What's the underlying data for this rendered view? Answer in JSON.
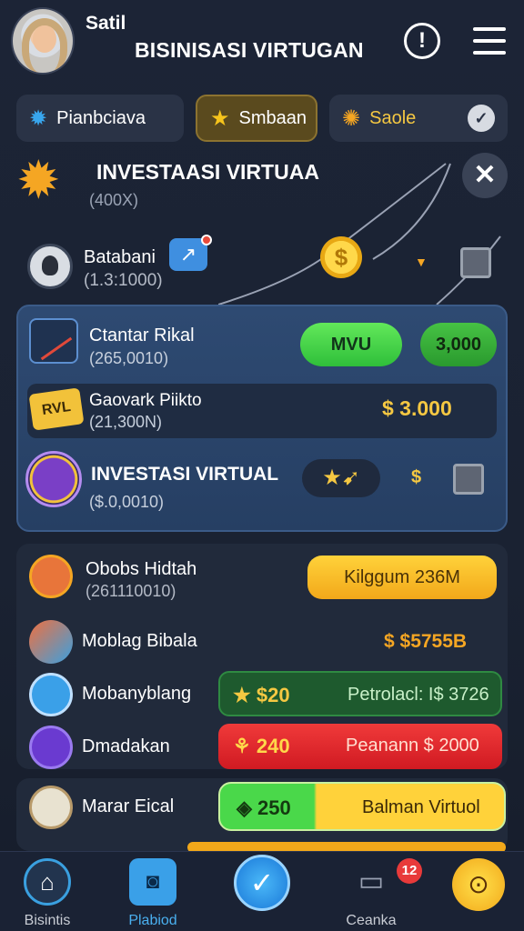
{
  "header": {
    "user_name": "Satil",
    "title": "BISINISASI VIRTUGAN"
  },
  "chips": [
    {
      "label": "Pianbciava",
      "icon": "gear-icon"
    },
    {
      "label": "Smbaan",
      "icon": "star-icon"
    },
    {
      "label": "Saole",
      "icon": "gear-icon"
    }
  ],
  "investasi": {
    "title": "INVESTAASI VIRTUAA",
    "sub": "(400X)"
  },
  "user_row": {
    "name": "Batabani",
    "sub": "(1.3:1000)"
  },
  "portfolio": {
    "r1": {
      "name": "Ctantar Rikal",
      "sub": "(265,0010)",
      "button": "MVU",
      "value": "3,000"
    },
    "r2": {
      "name": "Gaovark Piikto",
      "sub": "(21,300N)",
      "badge": "RVL",
      "value": "$ 3.000"
    },
    "r3": {
      "name": "INVESTASI VIRTUAL",
      "sub": "($.0,0010)",
      "dollar": "$"
    }
  },
  "list": {
    "l1": {
      "name": "Obobs Hidtah",
      "sub": "(261110010)",
      "button": "Kilggum 236M"
    },
    "l2": {
      "name": "Moblag Bibala",
      "value": "$ $5755B"
    },
    "l3": {
      "name": "Mobanyblang",
      "value": "$20",
      "text": "Petrolacl: I$ 3726"
    },
    "l4": {
      "name": "Dmadakan",
      "value": "240",
      "text": "Peanann $ 2000"
    },
    "l5": {
      "name": "Marar Eical",
      "value": "250",
      "text": "Balman Virtuol"
    }
  },
  "nav": [
    {
      "label": "Bisintis",
      "icon": "home-icon"
    },
    {
      "label": "Plabiod",
      "icon": "chart-icon"
    },
    {
      "label": "",
      "icon": "check-icon"
    },
    {
      "label": "Ceanka",
      "icon": "chat-icon",
      "badge": "12"
    },
    {
      "label": "",
      "icon": "search-icon"
    }
  ],
  "colors": {
    "accent": "#f5a623",
    "green": "#2fbf3a",
    "red": "#d01a22",
    "blue": "#3aa0e8"
  }
}
